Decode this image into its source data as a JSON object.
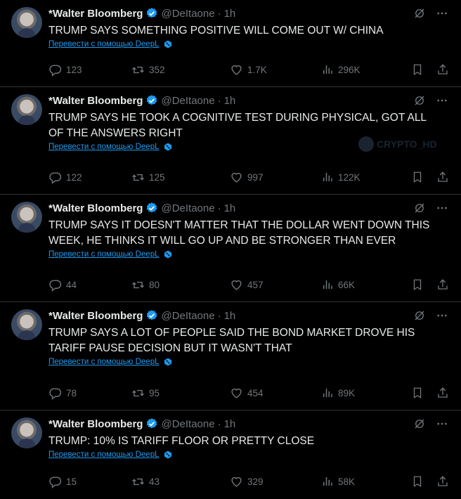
{
  "tweets": [
    {
      "name": "*Walter Bloomberg",
      "handle": "@DeItaone",
      "time": "1h",
      "lines": [
        "TRUMP SAYS SOMETHING POSITIVE WILL COME OUT W/ CHINA"
      ],
      "translate": "Перевести с помощью DeepL",
      "replies": "123",
      "reposts": "352",
      "likes": "1.7K",
      "views": "296K"
    },
    {
      "name": "*Walter Bloomberg",
      "handle": "@DeItaone",
      "time": "1h",
      "lines": [
        "TRUMP SAYS HE TOOK A COGNITIVE TEST DURING PHYSICAL, GOT ALL",
        "OF THE ANSWERS RIGHT"
      ],
      "translate": "Перевести с помощью DeepL",
      "replies": "122",
      "reposts": "125",
      "likes": "997",
      "views": "122K"
    },
    {
      "name": "*Walter Bloomberg",
      "handle": "@DeItaone",
      "time": "1h",
      "lines": [
        "TRUMP SAYS IT DOESN'T MATTER THAT THE DOLLAR WENT DOWN THIS",
        "WEEK, HE THINKS IT WILL GO UP AND BE STRONGER THAN EVER"
      ],
      "translate": "Перевести с помощью DeepL",
      "replies": "44",
      "reposts": "80",
      "likes": "457",
      "views": "66K"
    },
    {
      "name": "*Walter Bloomberg",
      "handle": "@DeItaone",
      "time": "1h",
      "lines": [
        "TRUMP SAYS A LOT OF PEOPLE SAID THE BOND MARKET DROVE HIS",
        "TARIFF PAUSE DECISION BUT IT WASN'T THAT"
      ],
      "translate": "Перевести с помощью DeepL",
      "replies": "78",
      "reposts": "95",
      "likes": "454",
      "views": "89K"
    },
    {
      "name": "*Walter Bloomberg",
      "handle": "@DeItaone",
      "time": "1h",
      "lines": [
        "TRUMP: 10% IS TARIFF FLOOR OR PRETTY CLOSE"
      ],
      "translate": "Перевести с помощью DeepL",
      "replies": "15",
      "reposts": "43",
      "likes": "329",
      "views": "58K"
    }
  ],
  "watermark": "CRYPTO_HD",
  "colors": {
    "background": "#000000",
    "text": "#e7e9ea",
    "muted": "#71767b",
    "link": "#1d9bf0",
    "verified": "#1d9bf0",
    "divider": "#2f3336"
  },
  "icons": [
    "verified-icon",
    "grok-icon",
    "more-icon",
    "deepl-icon",
    "reply-icon",
    "repost-icon",
    "like-icon",
    "views-icon",
    "bookmark-icon",
    "share-icon"
  ]
}
